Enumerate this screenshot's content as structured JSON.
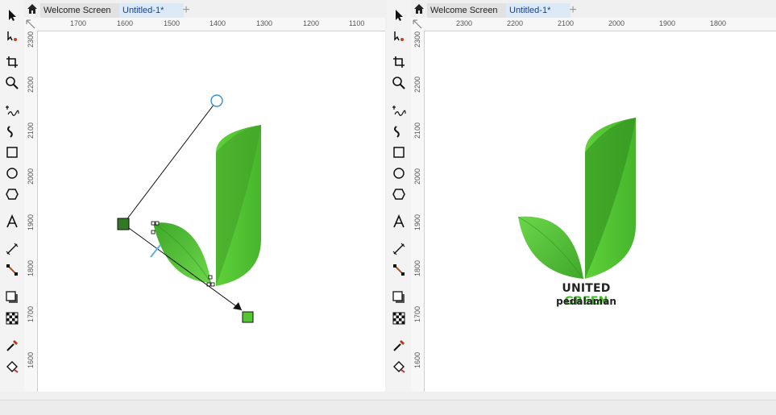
{
  "tabs": {
    "welcome": "Welcome Screen",
    "document": "Untitled-1*"
  },
  "left_pane": {
    "hruler": [
      "1700",
      "1600",
      "1500",
      "1400",
      "1300",
      "1200",
      "1100"
    ],
    "vruler": [
      "2300",
      "2200",
      "2100",
      "2000",
      "1900",
      "1800",
      "1700",
      "1600"
    ]
  },
  "right_pane": {
    "hruler": [
      "2300",
      "2200",
      "2100",
      "2000",
      "1900",
      "1800"
    ],
    "vruler": [
      "2300",
      "2200",
      "2100",
      "2000",
      "1900",
      "1800",
      "1700",
      "1600"
    ]
  },
  "logo": {
    "title_word1": "UNITED",
    "title_word2": "GREEN",
    "subtitle": "pedalaman",
    "colors": {
      "light_green": "#5fd13a",
      "dark_green": "#2e8a1e",
      "accent": "#42b72a"
    }
  },
  "tools": [
    "pick-tool",
    "shape-tool",
    "crop-tool",
    "zoom-tool",
    "freehand-tool",
    "artistic-media-tool",
    "rectangle-tool",
    "ellipse-tool",
    "polygon-tool",
    "text-tool",
    "parallel-dimension-tool",
    "connector-tool",
    "drop-shadow-tool",
    "transparency-tool",
    "eyedropper-tool",
    "interactive-fill-tool"
  ]
}
